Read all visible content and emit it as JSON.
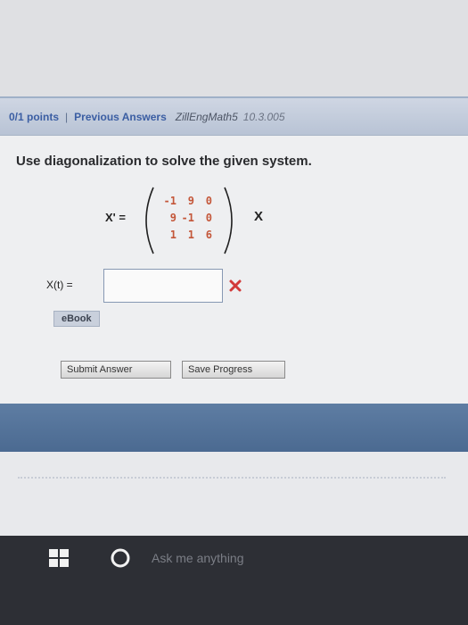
{
  "header": {
    "points": "0/1 points",
    "separator": "|",
    "previous_answers": "Previous Answers",
    "course": "ZillEngMath5",
    "course_section": "10.3.005"
  },
  "question": {
    "prompt": "Use diagonalization to solve the given system.",
    "lhs_label": "X' =",
    "rhs_var": "X",
    "matrix": [
      [
        "-1",
        "9",
        "0"
      ],
      [
        "9",
        "-1",
        "0"
      ],
      [
        "1",
        "1",
        "6"
      ]
    ],
    "answer_label": "X(t) =",
    "answer_value": ""
  },
  "buttons": {
    "ebook": "eBook",
    "submit": "Submit Answer",
    "save": "Save Progress"
  },
  "taskbar": {
    "search_placeholder": "Ask me anything"
  },
  "colors": {
    "matrix_entries": "#c4573a",
    "incorrect_mark": "#d23a3a",
    "link_blue": "#3b5ea3",
    "band_blue": "#4f6e94"
  },
  "icons": {
    "incorrect": "x-mark-icon",
    "start": "windows-logo-icon",
    "assistant": "cortana-circle-icon"
  }
}
